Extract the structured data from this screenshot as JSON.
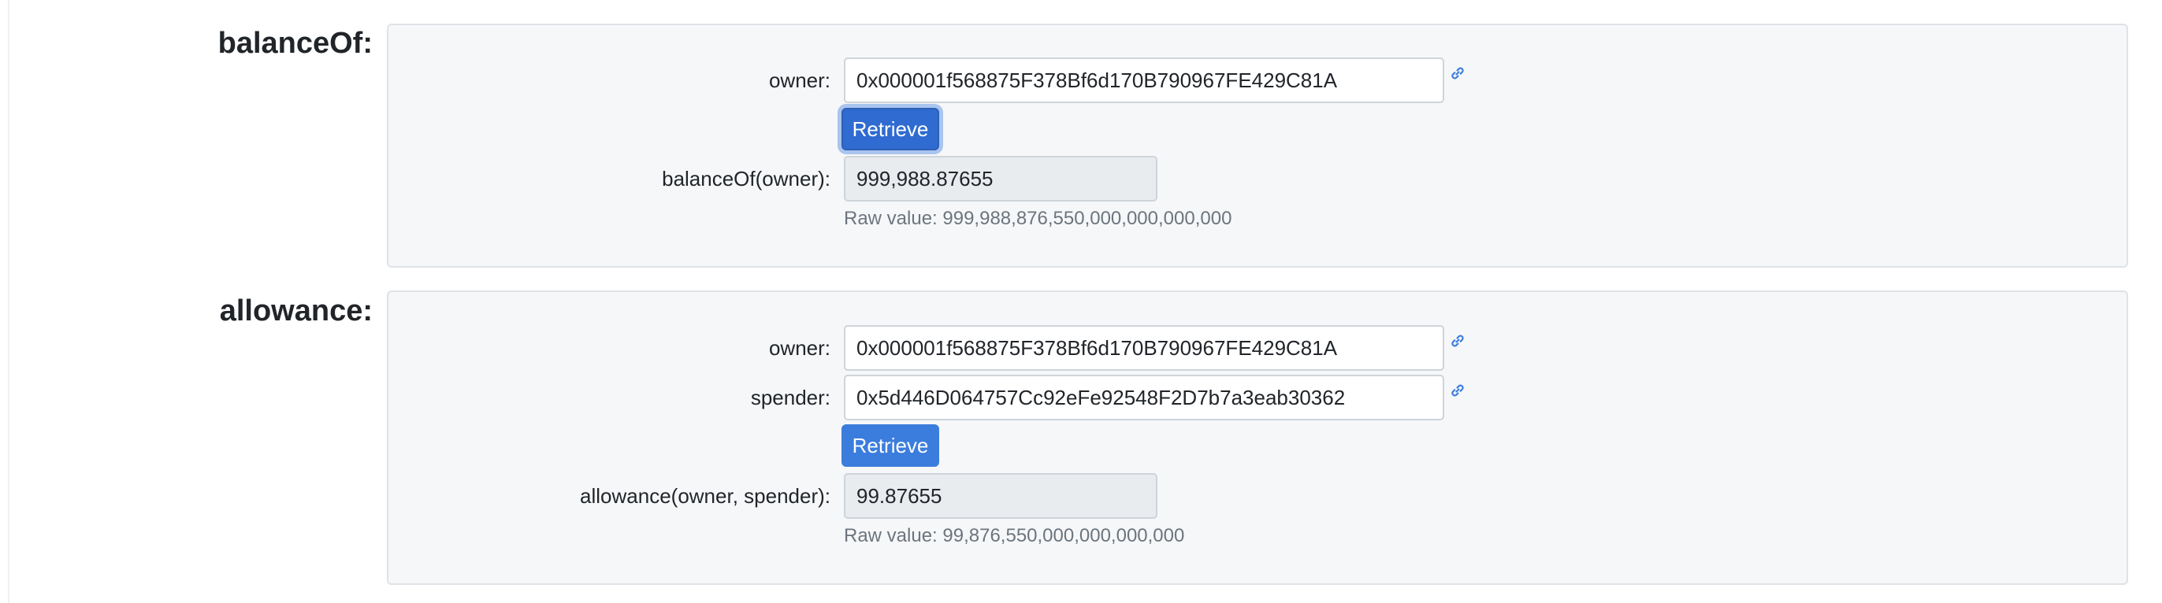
{
  "sections": {
    "balanceOf": {
      "title": "balanceOf:",
      "owner_label": "owner:",
      "owner_value": "0x000001f568875F378Bf6d170B790967FE429C81A",
      "button_label": "Retrieve",
      "result_label": "balanceOf(owner):",
      "result_value": "999,988.87655",
      "raw_value": "Raw value: 999,988,876,550,000,000,000,000"
    },
    "allowance": {
      "title": "allowance:",
      "owner_label": "owner:",
      "owner_value": "0x000001f568875F378Bf6d170B790967FE429C81A",
      "spender_label": "spender:",
      "spender_value": "0x5d446D064757Cc92eFe92548F2D7b7a3eab30362",
      "button_label": "Retrieve",
      "result_label": "allowance(owner, spender):",
      "result_value": "99.87655",
      "raw_value": "Raw value: 99,876,550,000,000,000,000"
    }
  },
  "icons": {
    "address_link": "link-icon"
  },
  "colors": {
    "primary": "#3b7ddd",
    "card_bg": "#f6f7f9",
    "muted_text": "#6c757d"
  }
}
